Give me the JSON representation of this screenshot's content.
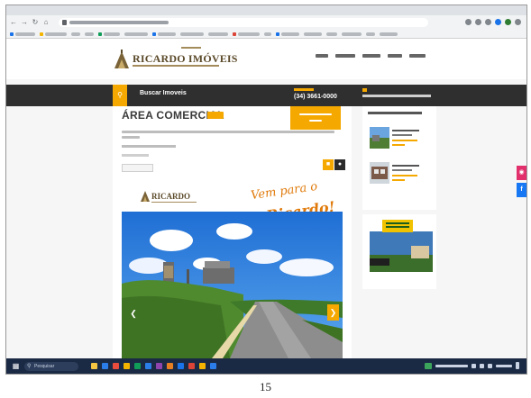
{
  "site": {
    "logo_text": "RICARDO IMÓVEIS",
    "search_label": "Buscar Imoveis",
    "phone": "(34) 3661-0000"
  },
  "listing": {
    "title": "ÁREA COMERCIAL"
  },
  "promo": {
    "logo_text": "RICARDO",
    "slogan_line1": "Vem para o",
    "slogan_line2": "Ricardo!"
  },
  "taskbar": {
    "search_label": "Pesquisar"
  },
  "footer": {
    "page_number": "15"
  },
  "colors": {
    "accent": "#f5a800",
    "dark_bar": "#2f2f2f",
    "slogan": "#e07a0a",
    "taskbar": "#1b2a44",
    "instagram": "#e1306c",
    "facebook": "#1877f2"
  },
  "icons": {
    "browser_nav": [
      "back-arrow-icon",
      "forward-arrow-icon",
      "reload-icon",
      "home-icon"
    ],
    "site": [
      "search-icon",
      "email-icon",
      "grid-icon",
      "share-icon",
      "chevron-left-icon",
      "chevron-right-icon"
    ],
    "social": [
      "instagram-icon",
      "facebook-icon"
    ],
    "taskbar": [
      "windows-start-icon",
      "search-icon"
    ]
  }
}
